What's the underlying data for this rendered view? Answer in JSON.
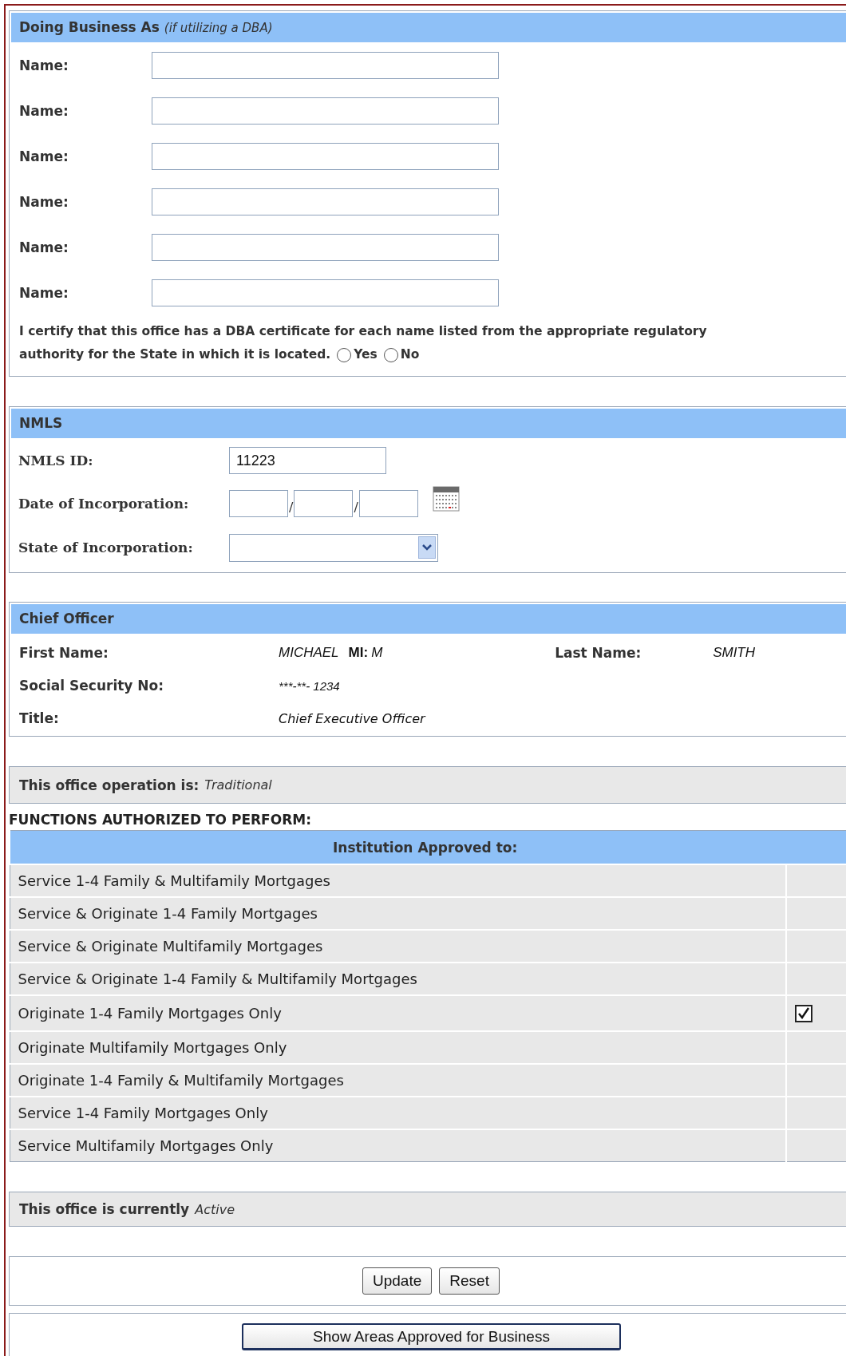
{
  "dba": {
    "title": "Doing Business As *(if utilizing a DBA)*",
    "names": [
      {
        "label": "Name:"
      },
      {
        "label": "Name:"
      },
      {
        "label": "Name:"
      },
      {
        "label": "Name:"
      },
      {
        "label": "Name:"
      },
      {
        "label": "Name:"
      }
    ],
    "certify_lines": [
      "I certify that this office has a DBA certificate for each name listed from the appropriate regulatory",
      "authority for the State in which it is located."
    ],
    "options": [
      {
        "label": "Yes",
        "selected": false
      },
      {
        "label": "No",
        "selected": false
      }
    ]
  },
  "nmls": {
    "title": "NMLS",
    "id_label": "NMLS ID:",
    "id_value": "11223",
    "date_label": "Date of Incorporation:",
    "date_separators": [
      "/",
      "/"
    ],
    "state_label": "State of Incorporation:"
  },
  "chief_officer": {
    "title": "Chief Officer",
    "first_name_label": "First Name:",
    "first_name": "MICHAEL",
    "mi_label": "MI:",
    "mi": "M",
    "last_name_label": "Last Name:",
    "last_name": "SMITH",
    "ssn_label": "Social Security No:",
    "ssn": "***-**- 1234",
    "title_label": "Title:",
    "title_value": "Chief Executive Officer"
  },
  "operation": {
    "label": "This office operation is:",
    "value": "Traditional"
  },
  "functions": {
    "heading": "FUNCTIONS AUTHORIZED TO PERFORM:",
    "table_header": "Institution Approved to:",
    "rows": [
      {
        "label": "Service 1-4 Family & Multifamily Mortgages",
        "checked": false
      },
      {
        "label": "Service & Originate 1-4 Family Mortgages",
        "checked": false
      },
      {
        "label": "Service & Originate Multifamily Mortgages",
        "checked": false
      },
      {
        "label": "Service & Originate 1-4 Family & Multifamily Mortgages",
        "checked": false
      },
      {
        "label": "Originate 1-4 Family Mortgages Only",
        "checked": true
      },
      {
        "label": "Originate Multifamily Mortgages Only",
        "checked": false
      },
      {
        "label": "Originate 1-4 Family & Multifamily Mortgages",
        "checked": false
      },
      {
        "label": "Service 1-4 Family Mortgages Only",
        "checked": false
      },
      {
        "label": "Service Multifamily Mortgages Only",
        "checked": false
      }
    ]
  },
  "status": {
    "label": "This office is currently",
    "value": "Active"
  },
  "buttons": [
    "Update",
    "Reset"
  ],
  "show_areas_button": "Show Areas Approved for Business"
}
